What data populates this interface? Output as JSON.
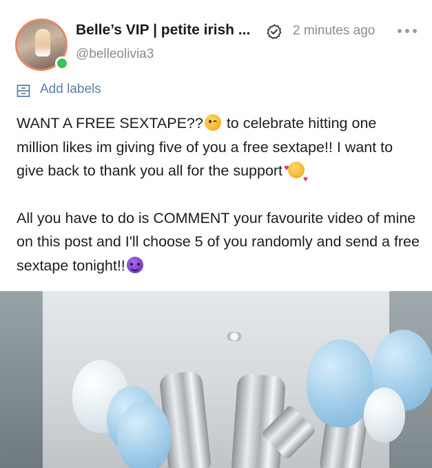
{
  "post": {
    "author_name": "Belle’s VIP | petite irish ...",
    "verified": true,
    "timestamp": "2 minutes ago",
    "handle": "@belleolivia3",
    "online": true,
    "labels_action": "Add labels",
    "paragraph1_part1": "WANT A FREE SEXTAPE??",
    "paragraph1_part2": " to celebrate hitting one million likes im giving five of you a free sextape!! I want to give back to thank you all for the support ",
    "paragraph2": "All you have to do is COMMENT your favourite video of mine on this post and I'll choose 5 of you randomly and send a free sextape tonight!!",
    "emojis": [
      "winking-face",
      "smiling-face-with-hearts",
      "smiling-face-with-horns"
    ]
  },
  "colors": {
    "avatar_ring": "#e8876a",
    "online": "#35c45a",
    "label_link": "#5b7fa8",
    "muted_text": "#8a8a92"
  },
  "icons": {
    "verified": "verified-badge-icon",
    "more": "more-horizontal-icon",
    "labels": "labels-icon"
  }
}
